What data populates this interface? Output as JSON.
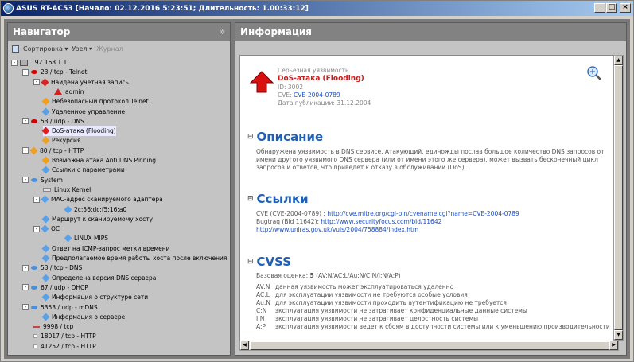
{
  "window": {
    "title": "ASUS RT-AC53 [Начало: 02.12.2016 5:23:51; Длительность: 1.00:33:12]",
    "min": "_",
    "max": "□",
    "close": "×"
  },
  "navigator": {
    "title": "Навигатор",
    "pin": "✲",
    "toolbar": {
      "sort": "Сортировка",
      "node": "Узел",
      "journal": "Журнал",
      "caret": "▾"
    },
    "tree": [
      {
        "label": "192.168.1.1",
        "icon": "host-red",
        "x": 4,
        "exp": "-"
      },
      {
        "label": "23 / tcp - Telnet",
        "icon": "port-red",
        "x": 18,
        "exp": "-"
      },
      {
        "label": "Найдена учетная запись",
        "icon": "vuln-red",
        "x": 32,
        "exp": "-"
      },
      {
        "label": "admin",
        "icon": "user-red",
        "x": 58
      },
      {
        "label": "Небезопасный протокол Telnet",
        "icon": "warn-orange",
        "x": 44
      },
      {
        "label": "Удаленное управление",
        "icon": "info-blue",
        "x": 44
      },
      {
        "label": "53 / udp - DNS",
        "icon": "port-red",
        "x": 18,
        "exp": "-"
      },
      {
        "label": "DoS-атака (Flooding)",
        "icon": "vuln-red",
        "x": 44,
        "selected": true
      },
      {
        "label": "Рекурсия",
        "icon": "warn-orange",
        "x": 44
      },
      {
        "label": "80 / tcp - HTTP",
        "icon": "port-orange",
        "x": 18,
        "exp": "-"
      },
      {
        "label": "Возможна атака Anti DNS Pinning",
        "icon": "warn-orange",
        "x": 44
      },
      {
        "label": "Ссылки с параметрами",
        "icon": "info-blue",
        "x": 44
      },
      {
        "label": "System",
        "icon": "port-blue",
        "x": 18,
        "exp": "-"
      },
      {
        "label": "Linux Kernel",
        "icon": "kernel",
        "x": 44
      },
      {
        "label": "MAC-адрес сканируемого адаптера",
        "icon": "info-blue",
        "x": 32,
        "exp": "-"
      },
      {
        "label": "2c:56:dc:f5:16:a0",
        "icon": "info-blue",
        "x": 72
      },
      {
        "label": "Маршрут к сканируемому хосту",
        "icon": "info-blue",
        "x": 44
      },
      {
        "label": "ОС",
        "icon": "info-blue",
        "x": 32,
        "exp": "-"
      },
      {
        "label": "LINUX MIPS",
        "icon": "info-blue",
        "x": 72
      },
      {
        "label": "Ответ на ICMP-запрос метки времени",
        "icon": "info-blue",
        "x": 44
      },
      {
        "label": "Предполагаемое время работы хоста после включения",
        "icon": "info-blue",
        "x": 44
      },
      {
        "label": "53 / tcp - DNS",
        "icon": "port-blue",
        "x": 18,
        "exp": "-"
      },
      {
        "label": "Определена версия DNS сервера",
        "icon": "info-blue",
        "x": 44
      },
      {
        "label": "67 / udp - DHCP",
        "icon": "port-blue",
        "x": 18,
        "exp": "-"
      },
      {
        "label": "Информация о структуре сети",
        "icon": "info-blue",
        "x": 44
      },
      {
        "label": "5353 / udp - mDNS",
        "icon": "port-blue",
        "x": 18,
        "exp": "-"
      },
      {
        "label": "Информация о сервере",
        "icon": "info-blue",
        "x": 44
      },
      {
        "label": "9998 / tcp",
        "icon": "port-dash",
        "x": 32
      },
      {
        "label": "18017 / tcp - HTTP",
        "icon": "port-dot",
        "x": 32
      },
      {
        "label": "41252 / tcp - HTTP",
        "icon": "port-dot",
        "x": 32
      }
    ]
  },
  "info": {
    "title": "Информация",
    "severity": "Серьезная уязвимость",
    "vuln_title": "DoS-атака (Flooding)",
    "id_label": "ID:",
    "id": "3002",
    "cve_label": "CVE:",
    "cve": "CVE-2004-0789",
    "pub_label": "Дата публикации:",
    "pub_date": "31.12.2004",
    "toggle": "⊟",
    "description": {
      "heading": "Описание",
      "text": "Обнаружена уязвимость в DNS сервисе. Атакующий, единожды послав большое количество DNS запросов от имени другого уязвимого DNS сервера (или от имени этого же сервера), может вызвать бесконечный цикл запросов и ответов, что приведет к отказу в обслуживании (DoS)."
    },
    "links": {
      "heading": "Ссылки",
      "items": [
        {
          "prefix": "CVE (CVE-2004-0789) : ",
          "url": "http://cve.mitre.org/cgi-bin/cvename.cgi?name=CVE-2004-0789"
        },
        {
          "prefix": "Bugtraq (Bid 11642): ",
          "url": "http://www.securityfocus.com/bid/11642"
        },
        {
          "prefix": "",
          "url": "http://www.uniras.gov.uk/vuls/2004/758884/index.htm"
        }
      ]
    },
    "cvss": {
      "heading": "CVSS",
      "base_label": "Базовая оценка:",
      "base_score": "5",
      "vector": "(AV:N/AC:L/Au:N/C:N/I:N/A:P)",
      "metrics": [
        {
          "key": "AV:N",
          "text": "данная уязвимость может эксплуатироваться удаленно"
        },
        {
          "key": "AC:L",
          "text": "для эксплуатации уязвимости не требуются особые условия"
        },
        {
          "key": "Au:N",
          "text": "для эксплуатации уязвимости проходить аутентификацию не требуется"
        },
        {
          "key": "C:N",
          "text": "эксплуатация уязвимости не затрагивает конфиденциальные данные системы"
        },
        {
          "key": "I:N",
          "text": "эксплуатация уязвимости не затрагивает целостность системы"
        },
        {
          "key": "A:P",
          "text": "эксплуатация уязвимости ведет к сбоям в доступности системы или к уменьшению производительности"
        }
      ]
    },
    "scroll": {
      "up": "▲",
      "down": "▼",
      "left": "◀",
      "right": "▶"
    }
  }
}
